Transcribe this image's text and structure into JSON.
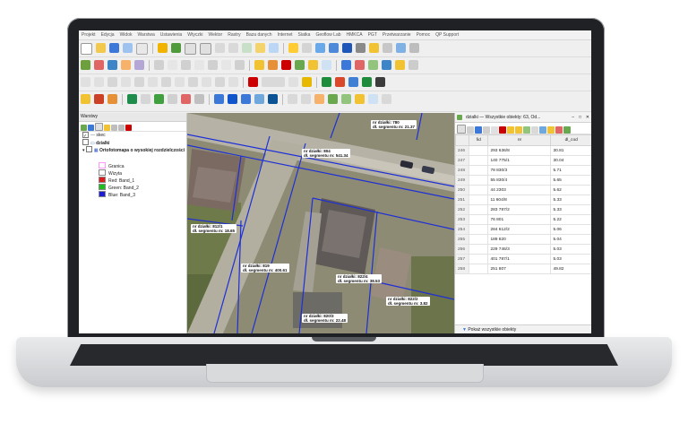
{
  "menu": [
    "Projekt",
    "Edycja",
    "Widok",
    "Warstwa",
    "Ustawienia",
    "Wtyczki",
    "Wektor",
    "Rastry",
    "Baza danych",
    "Internet",
    "Siatka",
    "Geoflow Lab",
    "HMKCA",
    "PGT",
    "Przetwarzanie",
    "Pomoc",
    "QP Support"
  ],
  "layers_panel": {
    "title": "Warstwy",
    "layers": [
      {
        "label": "skec",
        "checked": true
      },
      {
        "label": "dzialki",
        "checked": true
      },
      {
        "label": "Ortofotomapa o wysokiej rozdzielczości",
        "checked": true
      }
    ],
    "legend": [
      {
        "label": "Granica",
        "color": "#ffb6ff"
      },
      {
        "label": "Wizyta",
        "color": "#ffffff"
      },
      {
        "label": "Red: Band_1",
        "color": "#e11b1b"
      },
      {
        "label": "Green: Band_2",
        "color": "#19c019"
      },
      {
        "label": "Blue: Band_3",
        "color": "#1d1dd9"
      }
    ]
  },
  "map_labels": [
    {
      "l1": "nr działki: 780",
      "l2": "dł. segmentu m: 21.37"
    },
    {
      "l1": "nr działki: 804",
      "l2": "dł. segmentu m: 541.34"
    },
    {
      "l1": "nr działki: 812/1",
      "l2": "dł. segmentu m: 18.65"
    },
    {
      "l1": "nr działki: 819",
      "l2": "dł. segmentu m: 400.61"
    },
    {
      "l1": "nr działki: 822/4",
      "l2": "dł. segmentu m: 38.53"
    },
    {
      "l1": "nr działki: 822/2",
      "l2": "dł. segmentu m: 3.82"
    },
    {
      "l1": "nr działki: 820/3",
      "l2": "dł. segmentu m: 22.48"
    }
  ],
  "attribute_table": {
    "title": "dzialki — Wszystkie obiekty: 63, Od...",
    "columns": [
      "fid",
      "nr",
      "dl_cod"
    ],
    "rows": [
      {
        "n": "246",
        "fid": "",
        "nr": "293 636/8",
        "d": "30.81"
      },
      {
        "n": "247",
        "fid": "",
        "nr": "140 775/1",
        "d": "30.04"
      },
      {
        "n": "248",
        "fid": "",
        "nr": "78 830/3",
        "d": "5.71"
      },
      {
        "n": "249",
        "fid": "",
        "nr": "55 830/4",
        "d": "5.65"
      },
      {
        "n": "250",
        "fid": "",
        "nr": "44 2303",
        "d": "5.62"
      },
      {
        "n": "251",
        "fid": "",
        "nr": "11 604/8",
        "d": "5.33"
      },
      {
        "n": "252",
        "fid": "",
        "nr": "283 787/2",
        "d": "5.33"
      },
      {
        "n": "253",
        "fid": "",
        "nr": "76 801",
        "d": "5.22"
      },
      {
        "n": "254",
        "fid": "",
        "nr": "284 612/2",
        "d": "5.06"
      },
      {
        "n": "255",
        "fid": "",
        "nr": "189 820",
        "d": "5.04"
      },
      {
        "n": "256",
        "fid": "",
        "nr": "229 746/3",
        "d": "5.03"
      },
      {
        "n": "257",
        "fid": "",
        "nr": "401 787/1",
        "d": "5.03"
      },
      {
        "n": "258",
        "fid": "",
        "nr": "251 807",
        "d": "49.82"
      }
    ],
    "footer": "Pokaż wszystkie obiekty"
  }
}
